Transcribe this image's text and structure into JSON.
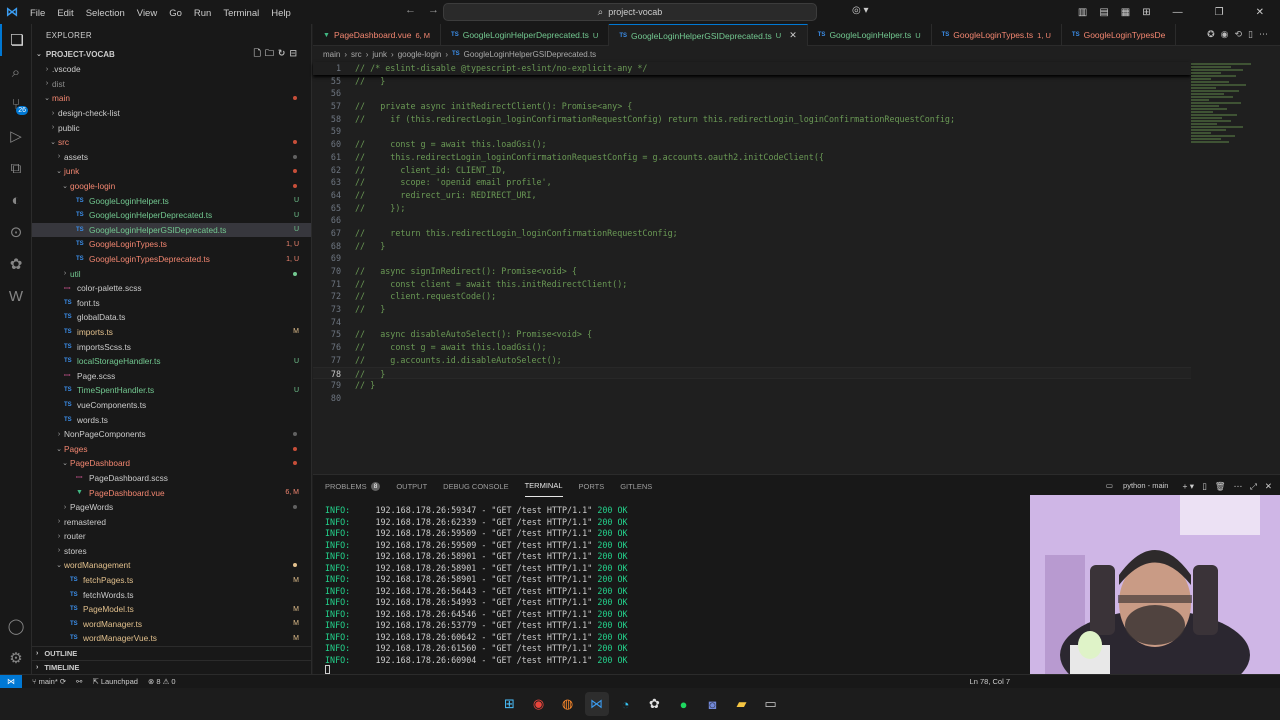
{
  "titlebar": {
    "menus": [
      "File",
      "Edit",
      "Selection",
      "View",
      "Go",
      "Run",
      "Terminal",
      "Help"
    ],
    "search": "project-vocab"
  },
  "sidebar": {
    "title": "EXPLORER",
    "project": "PROJECT-VOCAB",
    "tree": [
      {
        "label": ".vscode",
        "kind": "folder",
        "open": false,
        "depth": 1,
        "color": "plain"
      },
      {
        "label": "dist",
        "kind": "folder-plain",
        "open": false,
        "depth": 1,
        "color": "dim"
      },
      {
        "label": "main",
        "kind": "folder",
        "open": true,
        "depth": 1,
        "color": "error",
        "dot": "#c74e39"
      },
      {
        "label": "design-check-list",
        "kind": "folder",
        "open": false,
        "depth": 2,
        "color": "plain"
      },
      {
        "label": "public",
        "kind": "folder",
        "open": false,
        "depth": 2,
        "color": "plain"
      },
      {
        "label": "src",
        "kind": "folder",
        "open": true,
        "depth": 2,
        "color": "error",
        "dot": "#c74e39"
      },
      {
        "label": "assets",
        "kind": "folder",
        "open": false,
        "depth": 3,
        "color": "plain",
        "dot": "#616161"
      },
      {
        "label": "junk",
        "kind": "folder",
        "open": true,
        "depth": 3,
        "color": "error",
        "dot": "#c74e39"
      },
      {
        "label": "google-login",
        "kind": "folder",
        "open": true,
        "depth": 4,
        "color": "error",
        "dot": "#c74e39"
      },
      {
        "label": "GoogleLoginHelper.ts",
        "kind": "ts",
        "depth": 5,
        "color": "untracked",
        "status": "U"
      },
      {
        "label": "GoogleLoginHelperDeprecated.ts",
        "kind": "ts",
        "depth": 5,
        "color": "untracked",
        "status": "U"
      },
      {
        "label": "GoogleLoginHelperGSIDeprecated.ts",
        "kind": "ts",
        "depth": 5,
        "color": "untracked",
        "status": "U",
        "selected": true
      },
      {
        "label": "GoogleLoginTypes.ts",
        "kind": "ts",
        "depth": 5,
        "color": "error",
        "status": "1, U"
      },
      {
        "label": "GoogleLoginTypesDeprecated.ts",
        "kind": "ts",
        "depth": 5,
        "color": "error",
        "status": "1, U"
      },
      {
        "label": "util",
        "kind": "folder",
        "open": false,
        "depth": 4,
        "color": "untracked",
        "dot": "#73c991"
      },
      {
        "label": "color-palette.scss",
        "kind": "scss",
        "depth": 3,
        "color": "plain"
      },
      {
        "label": "font.ts",
        "kind": "ts",
        "depth": 3,
        "color": "plain"
      },
      {
        "label": "globalData.ts",
        "kind": "ts",
        "depth": 3,
        "color": "plain"
      },
      {
        "label": "imports.ts",
        "kind": "ts",
        "depth": 3,
        "color": "modified",
        "status": "M"
      },
      {
        "label": "importsScss.ts",
        "kind": "ts",
        "depth": 3,
        "color": "plain"
      },
      {
        "label": "localStorageHandler.ts",
        "kind": "ts",
        "depth": 3,
        "color": "untracked",
        "status": "U"
      },
      {
        "label": "Page.scss",
        "kind": "scss",
        "depth": 3,
        "color": "plain"
      },
      {
        "label": "TimeSpentHandler.ts",
        "kind": "ts",
        "depth": 3,
        "color": "untracked",
        "status": "U"
      },
      {
        "label": "vueComponents.ts",
        "kind": "ts",
        "depth": 3,
        "color": "plain"
      },
      {
        "label": "words.ts",
        "kind": "ts",
        "depth": 3,
        "color": "plain"
      },
      {
        "label": "NonPageComponents",
        "kind": "folder",
        "open": false,
        "depth": 3,
        "color": "plain",
        "dot": "#616161"
      },
      {
        "label": "Pages",
        "kind": "folder",
        "open": true,
        "depth": 3,
        "color": "error",
        "dot": "#c74e39"
      },
      {
        "label": "PageDashboard",
        "kind": "folder",
        "open": true,
        "depth": 4,
        "color": "error",
        "dot": "#c74e39"
      },
      {
        "label": "PageDashboard.scss",
        "kind": "scss",
        "depth": 5,
        "color": "plain"
      },
      {
        "label": "PageDashboard.vue",
        "kind": "vue",
        "depth": 5,
        "color": "error",
        "status": "6, M"
      },
      {
        "label": "PageWords",
        "kind": "folder",
        "open": false,
        "depth": 4,
        "color": "plain",
        "dot": "#616161"
      },
      {
        "label": "remastered",
        "kind": "folder",
        "open": false,
        "depth": 3,
        "color": "plain"
      },
      {
        "label": "router",
        "kind": "folder",
        "open": false,
        "depth": 3,
        "color": "plain"
      },
      {
        "label": "stores",
        "kind": "folder",
        "open": false,
        "depth": 3,
        "color": "plain"
      },
      {
        "label": "wordManagement",
        "kind": "folder",
        "open": true,
        "depth": 3,
        "color": "modified",
        "dot": "#e2c08d"
      },
      {
        "label": "fetchPages.ts",
        "kind": "ts",
        "depth": 4,
        "color": "modified",
        "status": "M"
      },
      {
        "label": "fetchWords.ts",
        "kind": "ts",
        "depth": 4,
        "color": "plain"
      },
      {
        "label": "PageModel.ts",
        "kind": "ts",
        "depth": 4,
        "color": "modified",
        "status": "M"
      },
      {
        "label": "wordManager.ts",
        "kind": "ts",
        "depth": 4,
        "color": "modified",
        "status": "M"
      },
      {
        "label": "wordManagerVue.ts",
        "kind": "ts",
        "depth": 4,
        "color": "modified",
        "status": "M"
      }
    ],
    "outline": "OUTLINE",
    "timeline": "TIMELINE"
  },
  "tabs": [
    {
      "label": "PageDashboard.vue",
      "tag": "6, M",
      "kind": "vue",
      "color": "#f48771"
    },
    {
      "label": "GoogleLoginHelperDeprecated.ts",
      "tag": "U",
      "kind": "ts",
      "color": "#73c991"
    },
    {
      "label": "GoogleLoginHelperGSIDeprecated.ts",
      "tag": "U",
      "kind": "ts",
      "color": "#73c991",
      "active": true
    },
    {
      "label": "GoogleLoginHelper.ts",
      "tag": "U",
      "kind": "ts",
      "color": "#73c991"
    },
    {
      "label": "GoogleLoginTypes.ts",
      "tag": "1, U",
      "kind": "ts",
      "color": "#f48771"
    },
    {
      "label": "GoogleLoginTypesDe",
      "tag": "",
      "kind": "ts",
      "color": "#f48771"
    }
  ],
  "breadcrumb": [
    "main",
    "src",
    "junk",
    "google-login",
    "GoogleLoginHelperGSIDeprecated.ts"
  ],
  "editor": {
    "sticky": {
      "num": "1",
      "text": "// /* eslint-disable @typescript-eslint/no-explicit-any */"
    },
    "lines": [
      {
        "num": "55",
        "text": "//   }"
      },
      {
        "num": "56",
        "text": ""
      },
      {
        "num": "57",
        "text": "//   private async initRedirectClient(): Promise<any> {"
      },
      {
        "num": "58",
        "text": "//     if (this.redirectLogin_loginConfirmationRequestConfig) return this.redirectLogin_loginConfirmationRequestConfig;"
      },
      {
        "num": "59",
        "text": ""
      },
      {
        "num": "60",
        "text": "//     const g = await this.loadGsi();"
      },
      {
        "num": "61",
        "text": "//     this.redirectLogin_loginConfirmationRequestConfig = g.accounts.oauth2.initCodeClient({"
      },
      {
        "num": "62",
        "text": "//       client_id: CLIENT_ID,"
      },
      {
        "num": "63",
        "text": "//       scope: 'openid email profile',"
      },
      {
        "num": "64",
        "text": "//       redirect_uri: REDIRECT_URI,"
      },
      {
        "num": "65",
        "text": "//     });"
      },
      {
        "num": "66",
        "text": ""
      },
      {
        "num": "67",
        "text": "//     return this.redirectLogin_loginConfirmationRequestConfig;"
      },
      {
        "num": "68",
        "text": "//   }"
      },
      {
        "num": "69",
        "text": ""
      },
      {
        "num": "70",
        "text": "//   async signInRedirect(): Promise<void> {"
      },
      {
        "num": "71",
        "text": "//     const client = await this.initRedirectClient();"
      },
      {
        "num": "72",
        "text": "//     client.requestCode();"
      },
      {
        "num": "73",
        "text": "//   }"
      },
      {
        "num": "74",
        "text": ""
      },
      {
        "num": "75",
        "text": "//   async disableAutoSelect(): Promise<void> {"
      },
      {
        "num": "76",
        "text": "//     const g = await this.loadGsi();"
      },
      {
        "num": "77",
        "text": "//     g.accounts.id.disableAutoSelect();"
      },
      {
        "num": "78",
        "text": "//   }",
        "current": true
      },
      {
        "num": "79",
        "text": "// }"
      },
      {
        "num": "80",
        "text": ""
      }
    ]
  },
  "panel": {
    "tabs": [
      "PROBLEMS",
      "OUTPUT",
      "DEBUG CONSOLE",
      "TERMINAL",
      "PORTS",
      "GITLENS"
    ],
    "active_tab": "TERMINAL",
    "problems_count": "8",
    "terminal_name": "python - main",
    "lines": [
      {
        "level": "INFO:",
        "addr": "192.168.178.26:59347",
        "req": "\"GET /test HTTP/1.1\"",
        "status": "200 OK"
      },
      {
        "level": "INFO:",
        "addr": "192.168.178.26:62339",
        "req": "\"GET /test HTTP/1.1\"",
        "status": "200 OK"
      },
      {
        "level": "INFO:",
        "addr": "192.168.178.26:59509",
        "req": "\"GET /test HTTP/1.1\"",
        "status": "200 OK"
      },
      {
        "level": "INFO:",
        "addr": "192.168.178.26:59509",
        "req": "\"GET /test HTTP/1.1\"",
        "status": "200 OK"
      },
      {
        "level": "INFO:",
        "addr": "192.168.178.26:58901",
        "req": "\"GET /test HTTP/1.1\"",
        "status": "200 OK"
      },
      {
        "level": "INFO:",
        "addr": "192.168.178.26:58901",
        "req": "\"GET /test HTTP/1.1\"",
        "status": "200 OK"
      },
      {
        "level": "INFO:",
        "addr": "192.168.178.26:58901",
        "req": "\"GET /test HTTP/1.1\"",
        "status": "200 OK"
      },
      {
        "level": "INFO:",
        "addr": "192.168.178.26:56443",
        "req": "\"GET /test HTTP/1.1\"",
        "status": "200 OK"
      },
      {
        "level": "INFO:",
        "addr": "192.168.178.26:54993",
        "req": "\"GET /test HTTP/1.1\"",
        "status": "200 OK"
      },
      {
        "level": "INFO:",
        "addr": "192.168.178.26:64546",
        "req": "\"GET /test HTTP/1.1\"",
        "status": "200 OK"
      },
      {
        "level": "INFO:",
        "addr": "192.168.178.26:53779",
        "req": "\"GET /test HTTP/1.1\"",
        "status": "200 OK"
      },
      {
        "level": "INFO:",
        "addr": "192.168.178.26:60642",
        "req": "\"GET /test HTTP/1.1\"",
        "status": "200 OK"
      },
      {
        "level": "INFO:",
        "addr": "192.168.178.26:61560",
        "req": "\"GET /test HTTP/1.1\"",
        "status": "200 OK"
      },
      {
        "level": "INFO:",
        "addr": "192.168.178.26:60904",
        "req": "\"GET /test HTTP/1.1\"",
        "status": "200 OK"
      }
    ]
  },
  "statusbar": {
    "branch": "main*",
    "launchpad": "Launchpad",
    "errors": "8",
    "warnings": "0",
    "position": "Ln 78, Col 7"
  },
  "taskbar": [
    "windows-start-icon",
    "chrome-icon",
    "firefox-icon",
    "vscode-icon",
    "edge-icon",
    "chatgpt-icon",
    "spotify-icon",
    "discord-icon",
    "file-explorer-icon",
    "terminal-icon"
  ]
}
